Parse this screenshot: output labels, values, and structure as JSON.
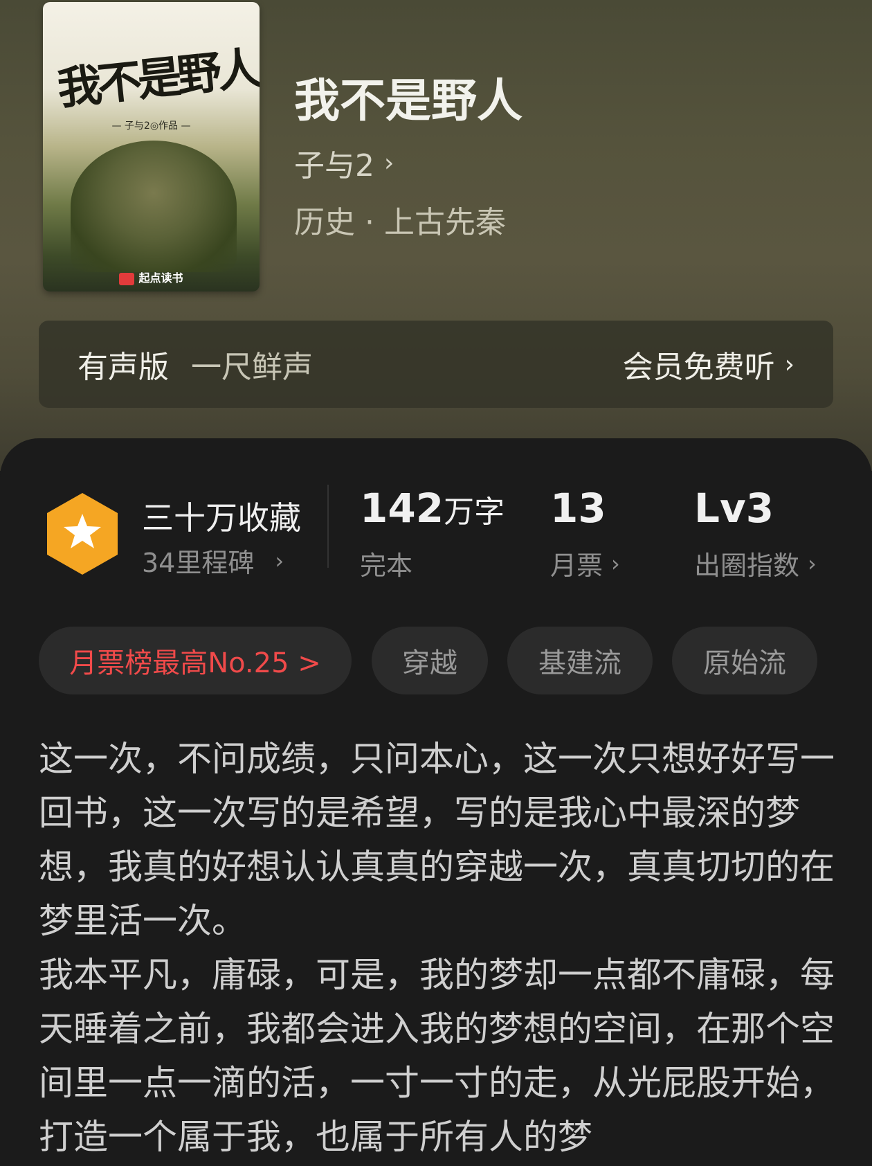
{
  "book": {
    "cover": {
      "title_art": "我不是野人",
      "author_line": "— 子与2◎作品 —",
      "brand": "起点读书"
    },
    "title": "我不是野人",
    "author": "子与2",
    "genre": "历史 · 上古先秦"
  },
  "audio": {
    "label": "有声版",
    "narrator": "一尺鲜声",
    "cta": "会员免费听"
  },
  "stats": {
    "favorites": {
      "title": "三十万收藏",
      "sub": "34里程碑"
    },
    "words": {
      "value": "142",
      "unit": "万字",
      "label": "完本"
    },
    "tickets": {
      "value": "13",
      "label": "月票"
    },
    "level": {
      "value": "Lv3",
      "label": "出圈指数"
    }
  },
  "tags": [
    {
      "label": "月票榜最高No.25 >"
    },
    {
      "label": "穿越"
    },
    {
      "label": "基建流"
    },
    {
      "label": "原始流"
    }
  ],
  "description": [
    "这一次，不问成绩，只问本心，这一次只想好好写一回书，这一次写的是希望，写的是我心中最深的梦想，我真的好想认认真真的穿越一次，真真切切的在梦里活一次。",
    "我本平凡，庸碌，可是，我的梦却一点都不庸碌，每天睡着之前，我都会进入我的梦想的空间，在那个空间里一点一滴的活，一寸一寸的走，从光屁股开始，打造一个属于我，也属于所有人的梦"
  ],
  "colors": {
    "hero_bg": "#55533c",
    "panel_bg": "#1b1b1b",
    "badge": "#f5a623",
    "rank_text": "#f04a4a"
  },
  "icons": {
    "badge": "star-hexagon-icon",
    "chevron": "chevron-right-icon"
  }
}
